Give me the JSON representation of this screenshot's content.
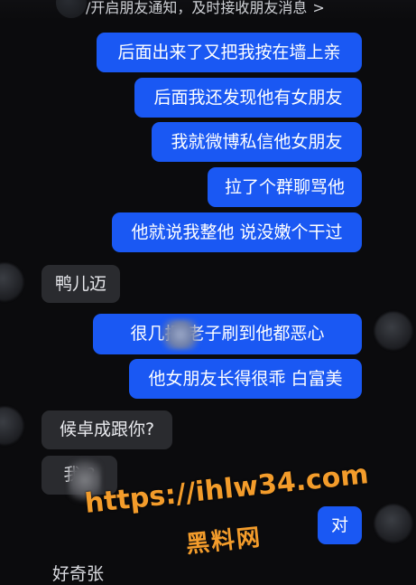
{
  "header": {
    "notice_text": "/开启朋友通知，及时接收朋友消息",
    "chevron": ">"
  },
  "messages": [
    {
      "side": "out",
      "text": "后面出来了又把我按在墙上亲"
    },
    {
      "side": "out",
      "text": "后面我还发现他有女朋友"
    },
    {
      "side": "out",
      "text": "我就微博私信他女朋友"
    },
    {
      "side": "out",
      "text": "拉了个群聊骂他"
    },
    {
      "side": "out",
      "text": "他就说我整他 说没嫩个干过"
    },
    {
      "side": "in",
      "text": "鸭儿迈"
    },
    {
      "side": "out",
      "text": "很几把    老子刷到他都恶心"
    },
    {
      "side": "out",
      "text": "他女朋友长得很乖 白富美"
    },
    {
      "side": "in",
      "text": "候卓成跟你?"
    },
    {
      "side": "in",
      "text": "我  ?"
    },
    {
      "side": "out",
      "text": "对"
    }
  ],
  "partial_bottom_text": "好奇张",
  "watermark": {
    "url": "https://ihlw34.com",
    "name": "黑料网",
    "color": "#f39c2b"
  },
  "colors": {
    "background": "#0b0b0d",
    "outgoing_bubble": "#1a58f3",
    "incoming_bubble": "#2a2b2f"
  }
}
